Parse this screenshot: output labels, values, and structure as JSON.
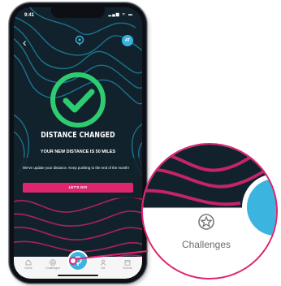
{
  "status": {
    "time": "9:41",
    "icons": "▂▄▆ ᯤ ▬"
  },
  "header": {
    "back_glyph": "‹",
    "avatar_initials": "AT"
  },
  "modal": {
    "headline": "DISTANCE CHANGED",
    "subline": "YOUR NEW DISTANCE IS 50 MILES",
    "body": "We've update your distance. Keep pushing to the end of the month!",
    "cta_label": "LET'S GO!"
  },
  "tabbar": {
    "items": [
      {
        "label": "Home",
        "icon": "home-icon"
      },
      {
        "label": "Challenges",
        "icon": "star-badge-icon"
      },
      {
        "label": "",
        "icon": "map-pin-icon"
      },
      {
        "label": "Me",
        "icon": "person-icon"
      },
      {
        "label": "Events",
        "icon": "calendar-icon"
      }
    ]
  },
  "callout": {
    "label": "Challenges",
    "icon": "star-badge-icon"
  },
  "colors": {
    "background": "#12222c",
    "accent_pink": "#e0256f",
    "accent_blue": "#3cb4e0",
    "check_green": "#2ecc71"
  }
}
